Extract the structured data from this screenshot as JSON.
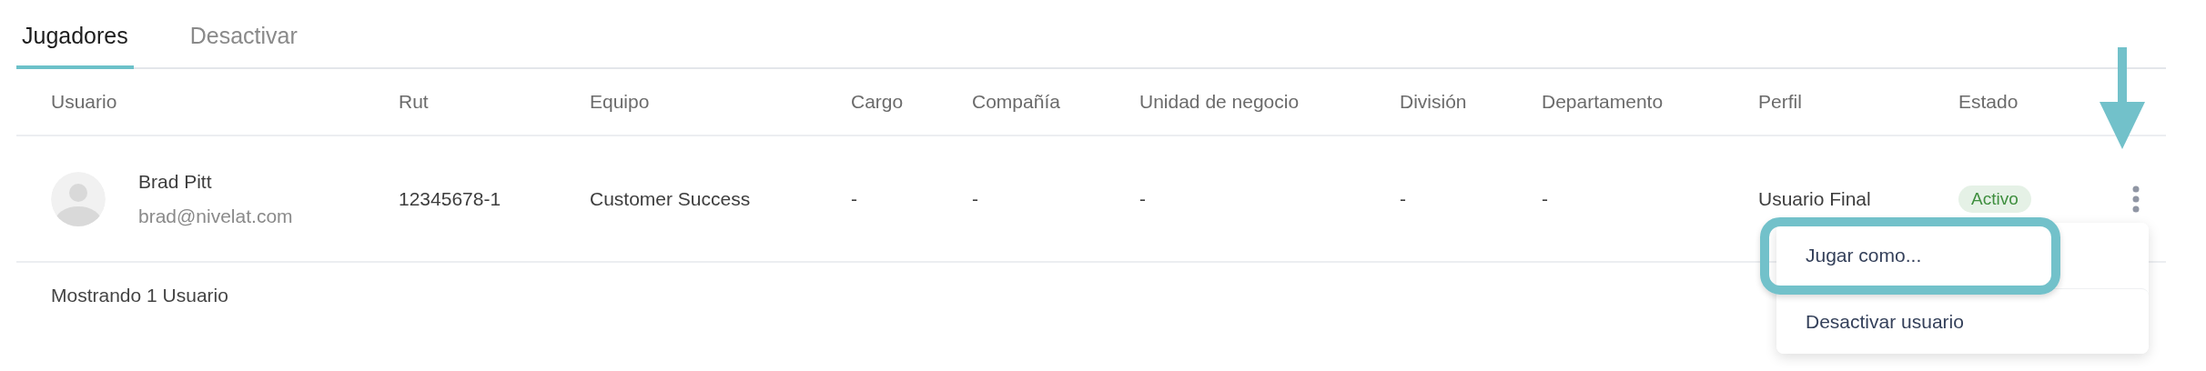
{
  "tabs": [
    {
      "label": "Jugadores",
      "selected": true
    },
    {
      "label": "Desactivar",
      "selected": false
    }
  ],
  "table": {
    "columns": [
      "Usuario",
      "Rut",
      "Equipo",
      "Cargo",
      "Compañía",
      "Unidad de negocio",
      "División",
      "Departamento",
      "Perfil",
      "Estado"
    ],
    "rows": [
      {
        "cells": [
          {
            "name": "Brad Pitt",
            "email": "brad@nivelat.com"
          },
          "12345678-1",
          "Customer Success",
          "-",
          "-",
          "-",
          "-",
          "-",
          "Usuario Final",
          "Activo"
        ]
      }
    ]
  },
  "footer": "Mostrando 1 Usuario",
  "row_menu": {
    "items": [
      {
        "label": "Jugar como...",
        "highlighted": true
      },
      {
        "label": "Desactivar usuario",
        "highlighted": false
      }
    ]
  }
}
